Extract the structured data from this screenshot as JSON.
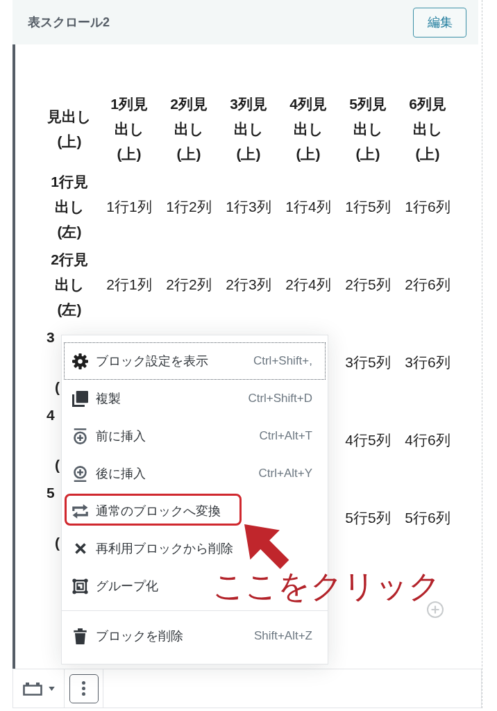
{
  "block": {
    "title": "表スクロール2",
    "edit_button": "編集"
  },
  "table": {
    "corner_header": "見出し(上)",
    "columns": [
      "1列見出し(上)",
      "2列見出し(上)",
      "3列見出し(上)",
      "4列見出し(上)",
      "5列見出し(上)",
      "6列見出し(上)"
    ],
    "rows": [
      {
        "kind": "full",
        "header": "1行見出し(左)",
        "cells": [
          "1行1列",
          "1行2列",
          "1行3列",
          "1行4列",
          "1行5列",
          "1行6列"
        ]
      },
      {
        "kind": "full",
        "header": "2行見出し(左)",
        "cells": [
          "2行1列",
          "2行2列",
          "2行3列",
          "2行4列",
          "2行5列",
          "2行6列"
        ]
      },
      {
        "kind": "covered",
        "header_parts": [
          "3",
          "("
        ],
        "cells": [
          "",
          "",
          "",
          "",
          "3行5列",
          "3行6列"
        ]
      },
      {
        "kind": "covered",
        "header_parts": [
          "4",
          "("
        ],
        "cells": [
          "",
          "",
          "",
          "",
          "4行5列",
          "4行6列"
        ]
      },
      {
        "kind": "covered",
        "header_parts": [
          "5",
          "("
        ],
        "cells": [
          "",
          "",
          "",
          "",
          "5行5列",
          "5行6列"
        ]
      }
    ]
  },
  "menu": {
    "groups": [
      {
        "items": [
          {
            "label": "ブロック設定を表示",
            "shortcut": "Ctrl+Shift+,",
            "focused": true,
            "highlighted": false
          },
          {
            "label": "複製",
            "shortcut": "Ctrl+Shift+D",
            "focused": false,
            "highlighted": false
          },
          {
            "label": "前に挿入",
            "shortcut": "Ctrl+Alt+T",
            "focused": false,
            "highlighted": false
          },
          {
            "label": "後に挿入",
            "shortcut": "Ctrl+Alt+Y",
            "focused": false,
            "highlighted": false
          },
          {
            "label": "通常のブロックへ変換",
            "focused": false,
            "highlighted": true
          },
          {
            "label": "再利用ブロックから削除",
            "focused": false,
            "highlighted": false
          },
          {
            "label": "グループ化",
            "focused": false,
            "highlighted": false
          }
        ]
      },
      {
        "items": [
          {
            "label": "ブロックを削除",
            "shortcut": "Shift+Alt+Z",
            "focused": false,
            "highlighted": false
          }
        ]
      }
    ]
  },
  "toolbar": {
    "more_button": {
      "expanded": true
    }
  },
  "annotation": {
    "text": "ここをクリック"
  }
}
